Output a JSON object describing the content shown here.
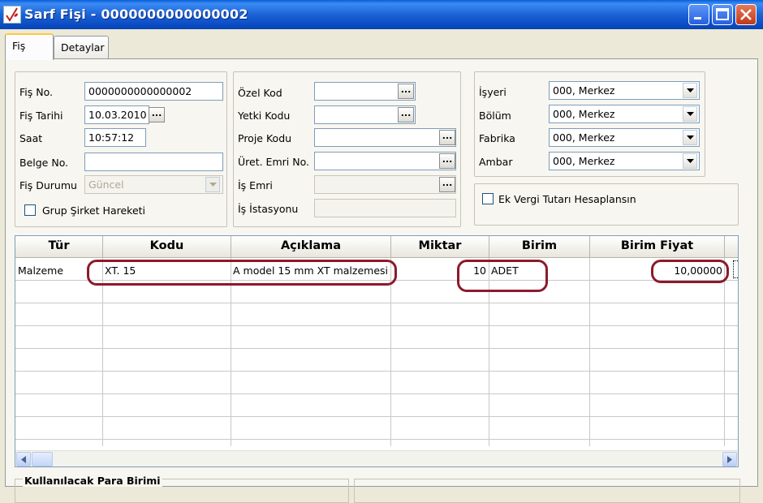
{
  "window": {
    "title": "Sarf Fişi - 0000000000000002"
  },
  "tabs": [
    {
      "label": "Fiş",
      "active": true
    },
    {
      "label": "Detaylar",
      "active": false
    }
  ],
  "left_group": {
    "fis_no": {
      "label": "Fiş No.",
      "value": "0000000000000002"
    },
    "fis_tarihi": {
      "label": "Fiş Tarihi",
      "value": "10.03.2010"
    },
    "saat": {
      "label": "Saat",
      "value": "10:57:12"
    },
    "belge_no": {
      "label": "Belge No.",
      "value": ""
    },
    "fis_durumu": {
      "label": "Fiş Durumu",
      "value": "Güncel"
    },
    "grup_sirket": {
      "label": "Grup Şirket Hareketi",
      "checked": false
    }
  },
  "middle_group": {
    "ozel_kod": {
      "label": "Özel Kod",
      "value": ""
    },
    "yetki_kodu": {
      "label": "Yetki Kodu",
      "value": ""
    },
    "proje_kodu": {
      "label": "Proje Kodu",
      "value": ""
    },
    "uret_emri": {
      "label": "Üret. Emri No.",
      "value": ""
    },
    "is_emri": {
      "label": "İş Emri",
      "value": ""
    },
    "is_istasyonu": {
      "label": "İş İstasyonu",
      "value": ""
    }
  },
  "right_group": {
    "isyeri": {
      "label": "İşyeri",
      "value": "000, Merkez"
    },
    "bolum": {
      "label": "Bölüm",
      "value": "000, Merkez"
    },
    "fabrika": {
      "label": "Fabrika",
      "value": "000, Merkez"
    },
    "ambar": {
      "label": "Ambar",
      "value": "000, Merkez"
    }
  },
  "ek_vergi": {
    "label": "Ek Vergi Tutarı Hesaplansın",
    "checked": false
  },
  "grid": {
    "columns": [
      "Tür",
      "Kodu",
      "Açıklama",
      "Miktar",
      "Birim",
      "Birim Fiyat"
    ],
    "rows": [
      {
        "tur": "Malzeme",
        "kodu": "XT. 15",
        "aciklama": "A model  15 mm  XT malzemesi",
        "miktar": "10",
        "birim": "ADET",
        "birim_fiyat": "10,00000"
      }
    ]
  },
  "bottom": {
    "para_birimi_label": "Kullanılacak Para Birimi"
  },
  "colors": {
    "titlebar": "#0B4CC4",
    "highlight_oval": "#8C1A2A",
    "tab_accent": "#FFC83C"
  }
}
